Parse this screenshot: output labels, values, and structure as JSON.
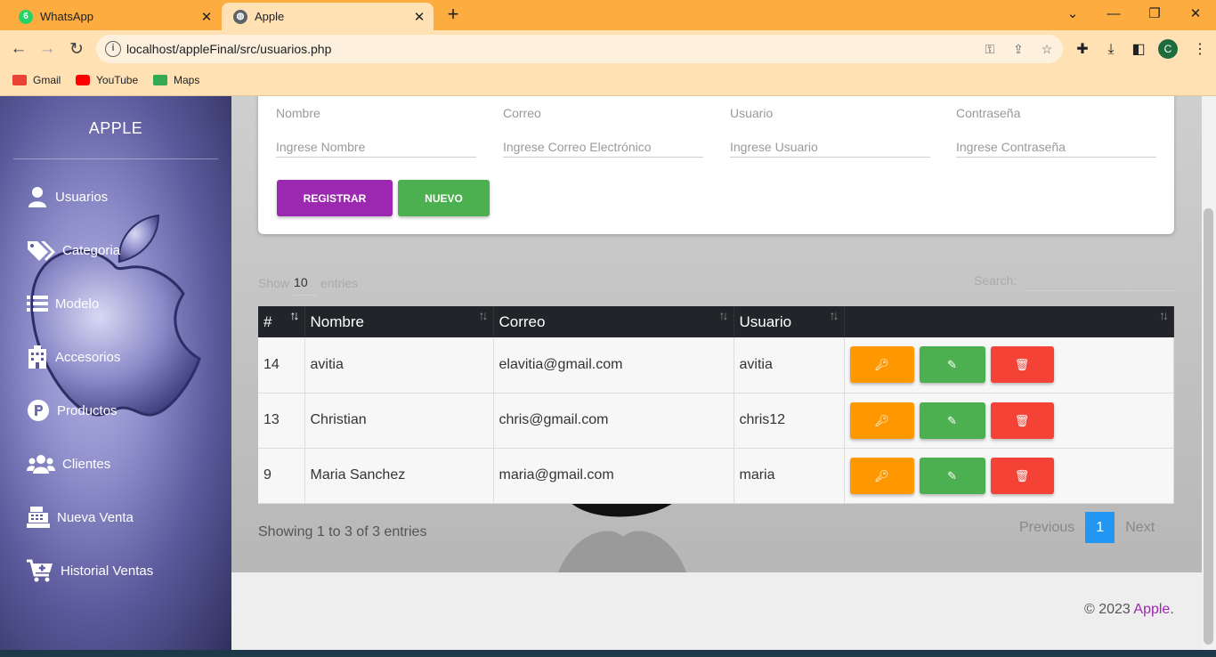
{
  "browser": {
    "tabs": [
      {
        "title": "WhatsApp",
        "favicon": "whatsapp-icon"
      },
      {
        "title": "Apple",
        "favicon": "globe-icon"
      }
    ],
    "url": "localhost/appleFinal/src/usuarios.php",
    "profile_initial": "C",
    "bookmarks": [
      {
        "label": "Gmail",
        "icon": "gmail-icon",
        "color": "#ea4335"
      },
      {
        "label": "YouTube",
        "icon": "youtube-icon",
        "color": "#ff0000"
      },
      {
        "label": "Maps",
        "icon": "maps-icon",
        "color": "#34a853"
      }
    ]
  },
  "sidebar": {
    "brand": "APPLE",
    "items": [
      {
        "label": "Usuarios",
        "icon": "user-icon"
      },
      {
        "label": "Categoria",
        "icon": "tags-icon"
      },
      {
        "label": "Modelo",
        "icon": "list-icon"
      },
      {
        "label": "Accesorios",
        "icon": "building-icon"
      },
      {
        "label": "Productos",
        "icon": "product-hunt-icon"
      },
      {
        "label": "Clientes",
        "icon": "users-icon"
      },
      {
        "label": "Nueva Venta",
        "icon": "cash-register-icon"
      },
      {
        "label": "Historial Ventas",
        "icon": "cart-plus-icon"
      }
    ]
  },
  "form": {
    "fields": [
      {
        "label": "Nombre",
        "placeholder": "Ingrese Nombre"
      },
      {
        "label": "Correo",
        "placeholder": "Ingrese Correo Electrónico"
      },
      {
        "label": "Usuario",
        "placeholder": "Ingrese Usuario"
      },
      {
        "label": "Contraseña",
        "placeholder": "Ingrese Contraseña"
      }
    ],
    "register_label": "REGISTRAR",
    "new_label": "NUEVO"
  },
  "table": {
    "length_prefix": "Show",
    "length_value": "10",
    "length_suffix": "entries",
    "search_label": "Search:",
    "columns": [
      "#",
      "Nombre",
      "Correo",
      "Usuario",
      ""
    ],
    "rows": [
      {
        "id": "14",
        "nombre": "avitia",
        "correo": "elavitia@gmail.com",
        "usuario": "avitia"
      },
      {
        "id": "13",
        "nombre": "Christian",
        "correo": "chris@gmail.com",
        "usuario": "chris12"
      },
      {
        "id": "9",
        "nombre": "Maria Sanchez",
        "correo": "maria@gmail.com",
        "usuario": "maria"
      }
    ],
    "info": "Showing 1 to 3 of 3 entries",
    "pagination": {
      "previous": "Previous",
      "current": "1",
      "next": "Next"
    }
  },
  "footer": {
    "prefix": "© 2023 ",
    "brand": "Apple",
    "suffix": "."
  },
  "colors": {
    "tabbar": "#fdad3f",
    "primary": "#9c27b0",
    "success": "#4caf50",
    "warning": "#ff9800",
    "danger": "#f44336",
    "info": "#2196f3"
  }
}
